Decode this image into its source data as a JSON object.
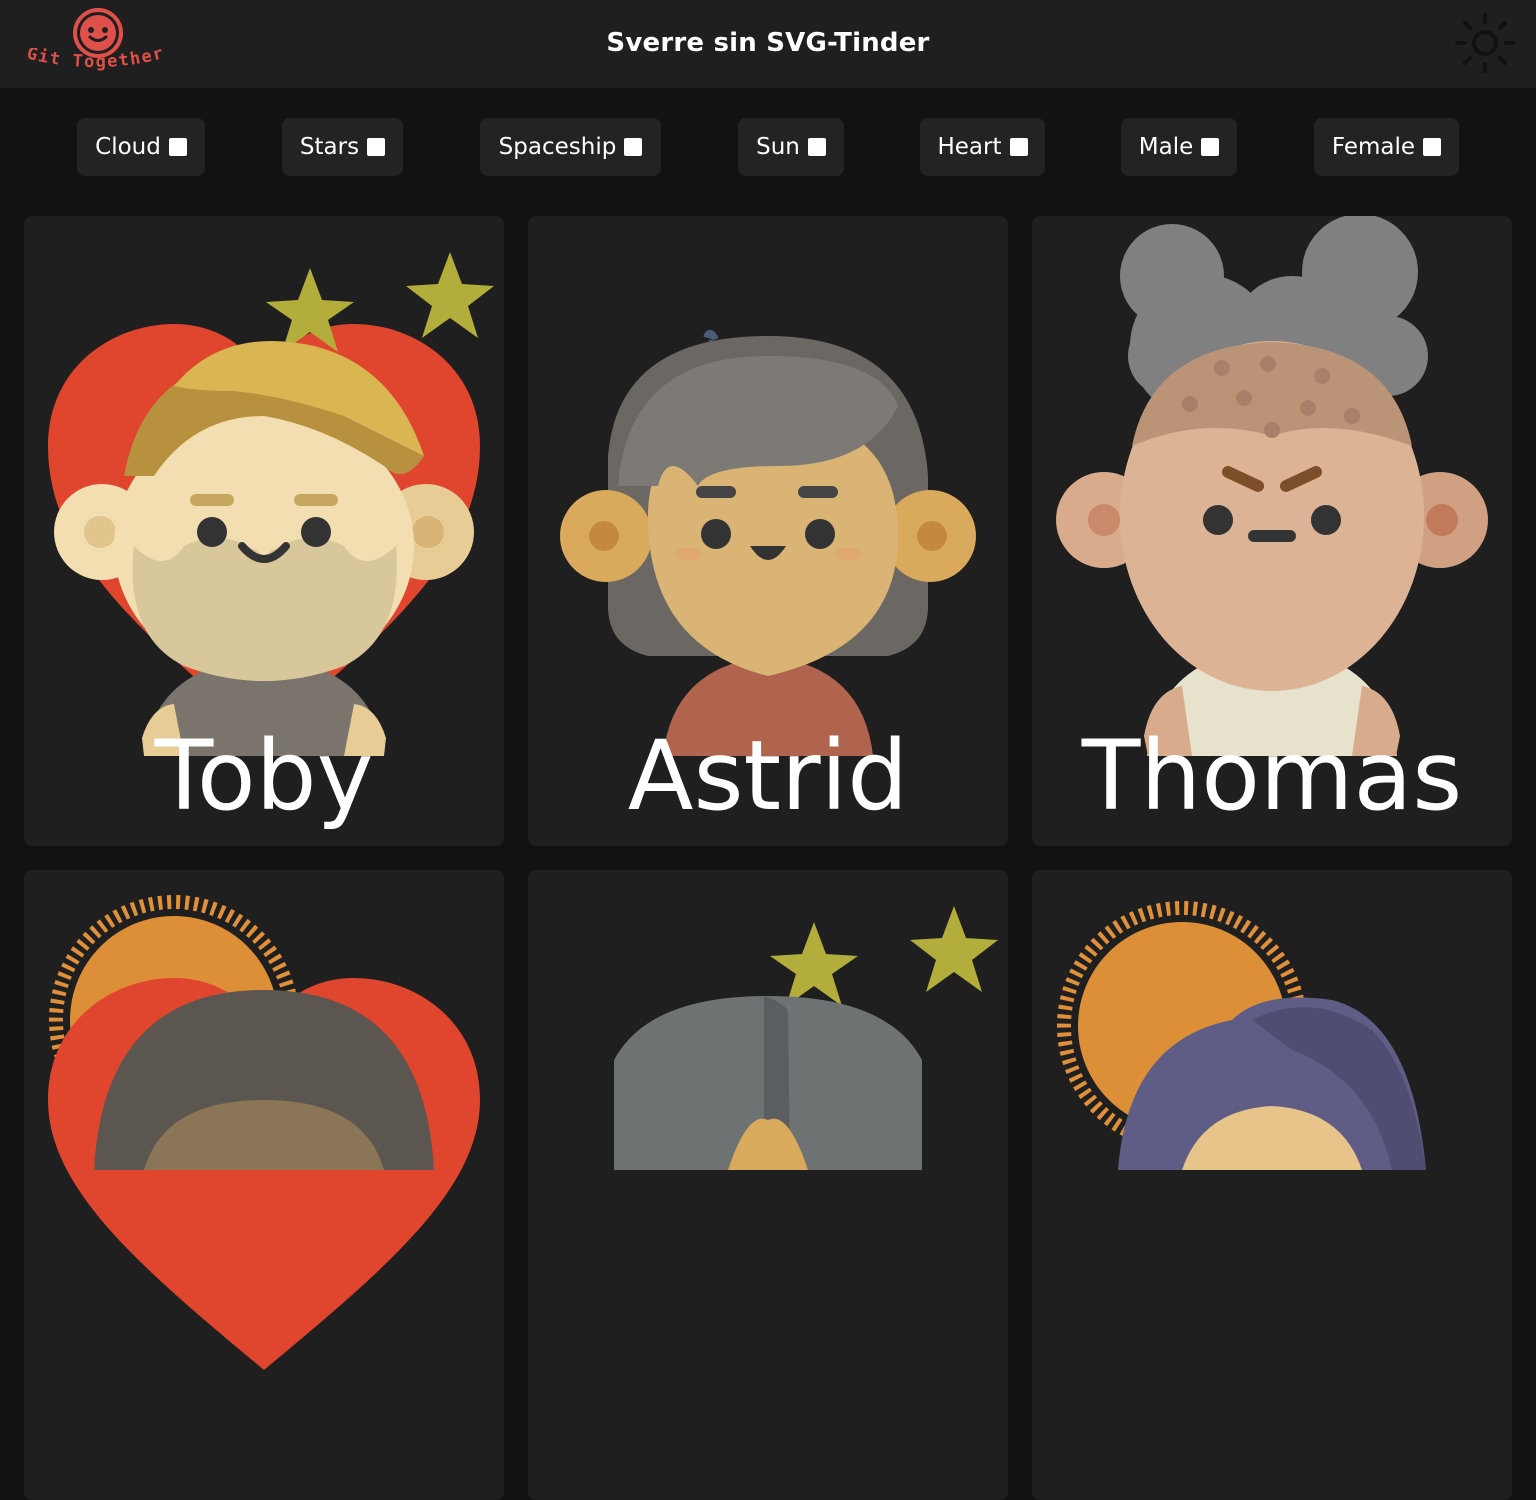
{
  "header": {
    "logo_text": "Git Together",
    "title": "Sverre sin SVG-Tinder",
    "theme_toggle_icon": "sun-icon"
  },
  "filters": [
    {
      "label": "Cloud",
      "checked": false
    },
    {
      "label": "Stars",
      "checked": false
    },
    {
      "label": "Spaceship",
      "checked": false
    },
    {
      "label": "Sun",
      "checked": false
    },
    {
      "label": "Heart",
      "checked": false
    },
    {
      "label": "Male",
      "checked": false
    },
    {
      "label": "Female",
      "checked": false
    }
  ],
  "profiles": [
    {
      "name": "Toby"
    },
    {
      "name": "Astrid"
    },
    {
      "name": "Thomas"
    },
    {
      "name": ""
    },
    {
      "name": ""
    },
    {
      "name": ""
    }
  ],
  "colors": {
    "background": "#121212",
    "surface": "#1f1f1f",
    "logo": "#e0504a",
    "heart": "#e0452e",
    "star": "#b3ad3c",
    "sun": "#e0903a"
  }
}
